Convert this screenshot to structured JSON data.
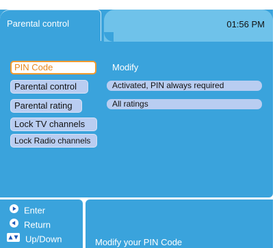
{
  "header": {
    "title": "Parental control",
    "time": "01:56 PM"
  },
  "menu": {
    "items": [
      {
        "label": "PIN Code",
        "selected": true
      },
      {
        "label": "Parental control",
        "selected": false
      },
      {
        "label": "Parental rating",
        "selected": false
      },
      {
        "label": "Lock TV channels",
        "selected": false
      },
      {
        "label": "Lock Radio channels",
        "selected": false
      }
    ]
  },
  "values": {
    "pin_code": "Modify",
    "parental_control": "Activated, PIN always required",
    "parental_rating": "All ratings"
  },
  "hints": {
    "enter": "Enter",
    "return": "Return",
    "updown": "Up/Down"
  },
  "help": {
    "text": "Modify your PIN Code"
  },
  "colors": {
    "panel": "#3aa3dc",
    "clock_bar": "#6fc2ea",
    "button": "#b9cdf1",
    "selected_border": "#f29a2e",
    "selected_text": "#e8861a"
  },
  "icons": {
    "enter": "play-right-icon",
    "return": "play-left-icon",
    "updown": "up-down-arrows-icon"
  }
}
